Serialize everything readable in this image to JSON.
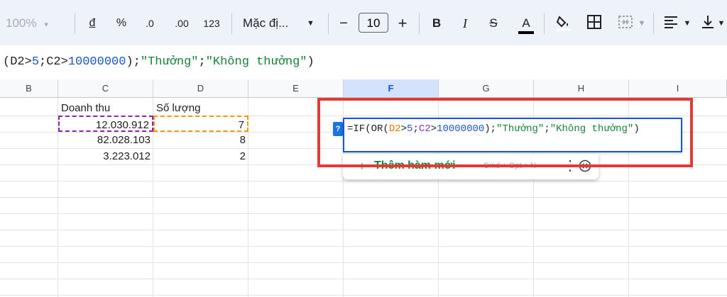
{
  "toolbar": {
    "zoom": "100%",
    "currency": "đ",
    "percent": "%",
    "dec_decrease": ".0",
    "dec_increase": ".00",
    "number_format": "123",
    "font_name": "Mặc đị...",
    "minus": "−",
    "font_size": "10",
    "plus": "+",
    "bold": "B",
    "italic": "I",
    "strike": "S",
    "text_color": "A",
    "text_color_bar": "#000000",
    "icons": [
      "fill-color-icon",
      "borders-icon",
      "merge-cells-icon",
      "align-left-icon",
      "valign-bottom-icon"
    ]
  },
  "formula_bar": {
    "parts": [
      {
        "t": "(D2>",
        "c": "plain"
      },
      {
        "t": "5",
        "c": "blue"
      },
      {
        "t": ";C2>",
        "c": "plain"
      },
      {
        "t": "10000000",
        "c": "blue"
      },
      {
        "t": ");",
        "c": "plain"
      },
      {
        "t": "\"Thưởng\"",
        "c": "green"
      },
      {
        "t": ";",
        "c": "plain"
      },
      {
        "t": "\"Không thưởng\"",
        "c": "green"
      },
      {
        "t": ")",
        "c": "plain"
      }
    ]
  },
  "columns": [
    {
      "name": "B"
    },
    {
      "name": "C"
    },
    {
      "name": "D"
    },
    {
      "name": "E"
    },
    {
      "name": "F",
      "selected": true
    },
    {
      "name": "G"
    },
    {
      "name": "H"
    },
    {
      "name": "I"
    }
  ],
  "sheet": {
    "header_c": "Doanh thu",
    "header_d": "Số lượng",
    "rows": [
      {
        "c": "12.030.912",
        "d": "7"
      },
      {
        "c": "82.028.103",
        "d": "8"
      },
      {
        "c": "3.223.012",
        "d": "2"
      }
    ]
  },
  "editor": {
    "help_badge": "?",
    "parts": [
      {
        "t": "=IF(OR(",
        "c": "plain"
      },
      {
        "t": "D2",
        "c": "orange"
      },
      {
        "t": ">",
        "c": "plain"
      },
      {
        "t": "5",
        "c": "blue"
      },
      {
        "t": ";",
        "c": "plain"
      },
      {
        "t": "C2",
        "c": "purple"
      },
      {
        "t": ">",
        "c": "plain"
      },
      {
        "t": "10000000",
        "c": "blue"
      },
      {
        "t": ");",
        "c": "plain"
      },
      {
        "t": "\"Thưởng\"",
        "c": "green"
      },
      {
        "t": ";",
        "c": "plain"
      },
      {
        "t": "\"Không thưởng\"",
        "c": "green"
      },
      {
        "t": ")",
        "c": "plain"
      }
    ]
  },
  "suggestion": {
    "plus": "+",
    "label": "Thêm hàm mới",
    "shortcut": "Cmd + Opt + N",
    "more": "⋮"
  },
  "colors": {
    "highlight_red": "#e53935",
    "selected_col": "#d3e3fd",
    "accent_blue": "#1a56c9",
    "formula_green": "#188038"
  }
}
